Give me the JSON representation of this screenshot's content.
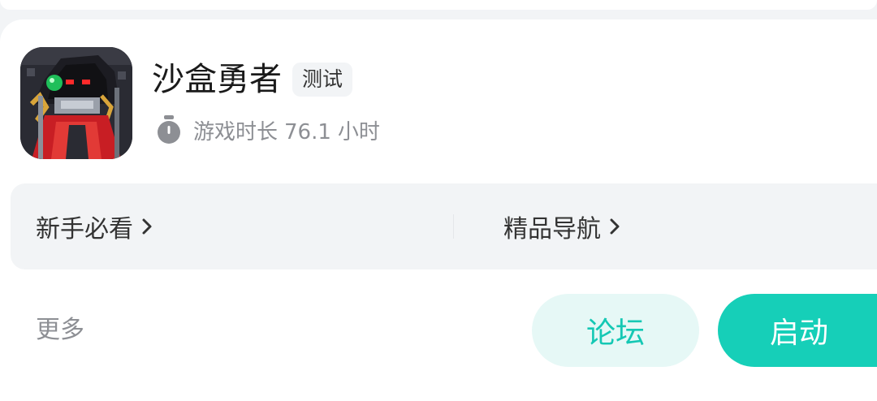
{
  "game": {
    "title": "沙盒勇者",
    "badge": "测试",
    "playtime_label": "游戏时长",
    "playtime_value": "76.1",
    "playtime_unit": "小时"
  },
  "links": [
    {
      "label": "新手必看",
      "icon": "chevron-right-icon"
    },
    {
      "label": "精品导航",
      "icon": "chevron-right-icon"
    }
  ],
  "footer": {
    "more_label": "更多",
    "forum_label": "论坛",
    "launch_label": "启动"
  },
  "colors": {
    "accent": "#16cfb8",
    "accent_light_bg": "#e6f8f6",
    "accent_text": "#15c8b4",
    "panel_bg": "#f2f4f6",
    "muted_text": "#8d8f94"
  },
  "icons": {
    "game_icon": "pixel-hooded-mage-icon",
    "timer": "stopwatch-icon"
  }
}
